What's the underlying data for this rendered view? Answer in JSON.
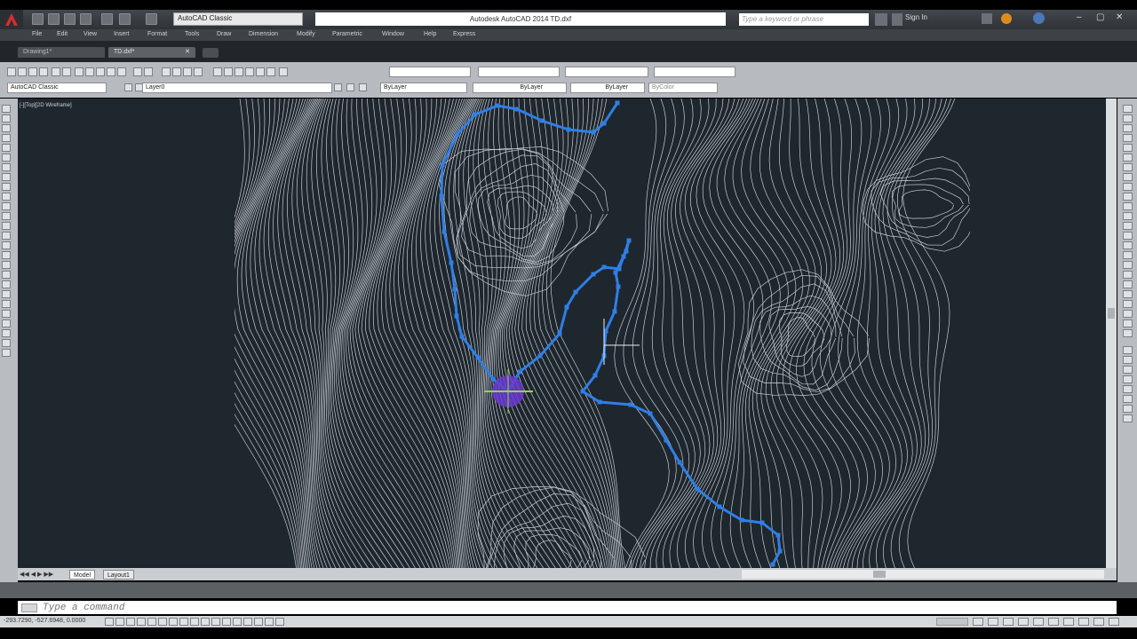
{
  "app": {
    "title": "Autodesk AutoCAD 2014    TD.dxf",
    "workspace": "AutoCAD Classic",
    "search_placeholder": "Type a keyword or phrase",
    "sign_in": "Sign In"
  },
  "menu": [
    "File",
    "Edit",
    "View",
    "Insert",
    "Format",
    "Tools",
    "Draw",
    "Dimension",
    "Modify",
    "Parametric",
    "Window",
    "Help",
    "Express"
  ],
  "tabs": [
    {
      "label": "Drawing1*"
    },
    {
      "label": "TD.dxf*"
    }
  ],
  "toolbar": {
    "workspace": "AutoCAD Classic",
    "layer": "Layer0",
    "color": "ByLayer",
    "linetype": "ByLayer",
    "lineweight": "ByLayer",
    "plotstyle": "ByColor"
  },
  "viewport": {
    "label": "[-][Top][2D Wireframe]"
  },
  "layout_tabs": [
    "Model",
    "Layout1"
  ],
  "command": {
    "placeholder": "Type a command"
  },
  "status": {
    "coordinates": "-293.7290, -527.6948, 0.0000"
  },
  "colors": {
    "viewport_bg": "#1e262e",
    "contour": "#c8ccd2",
    "polyline": "#2f7fe6",
    "marker": "#6a3ad0"
  }
}
